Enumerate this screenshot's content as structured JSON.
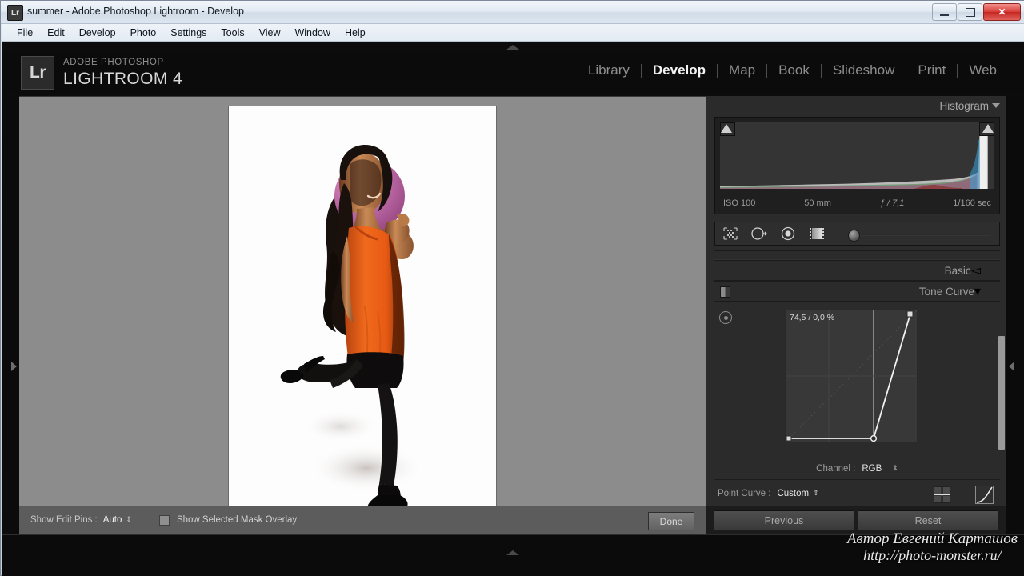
{
  "window": {
    "title": "summer - Adobe Photoshop Lightroom - Develop",
    "app_icon": "Lr",
    "minimize_label": "Minimize",
    "maximize_label": "Maximize",
    "close_label": "✕"
  },
  "menu": {
    "items": [
      {
        "label": "File"
      },
      {
        "label": "Edit"
      },
      {
        "label": "Develop"
      },
      {
        "label": "Photo"
      },
      {
        "label": "Settings"
      },
      {
        "label": "Tools"
      },
      {
        "label": "View"
      },
      {
        "label": "Window"
      },
      {
        "label": "Help"
      }
    ]
  },
  "identity": {
    "badge": "Lr",
    "line1": "ADOBE PHOTOSHOP",
    "line2": "LIGHTROOM 4"
  },
  "modules": {
    "items": [
      {
        "label": "Library",
        "active": false
      },
      {
        "label": "Develop",
        "active": true
      },
      {
        "label": "Map",
        "active": false
      },
      {
        "label": "Book",
        "active": false
      },
      {
        "label": "Slideshow",
        "active": false
      },
      {
        "label": "Print",
        "active": false
      },
      {
        "label": "Web",
        "active": false
      }
    ]
  },
  "histogram": {
    "title": "Histogram",
    "meta": {
      "iso": "ISO 100",
      "focal": "50 mm",
      "aperture": "ƒ / 7,1",
      "shutter": "1/160 sec"
    },
    "shadow_clip_label": "Shadow clipping",
    "highlight_clip_label": "Highlight clipping"
  },
  "tools": {
    "items": [
      {
        "name": "crop-overlay-tool",
        "label": "Crop Overlay"
      },
      {
        "name": "spot-removal-tool",
        "label": "Spot Removal"
      },
      {
        "name": "red-eye-tool",
        "label": "Red Eye Correction"
      },
      {
        "name": "graduated-filter-tool",
        "label": "Graduated Filter"
      },
      {
        "name": "adjustment-brush-tool",
        "label": "Adjustment Brush"
      }
    ]
  },
  "panels": {
    "basic": {
      "title": "Basic"
    },
    "tone_curve": {
      "title": "Tone Curve",
      "readout": "74,5 / 0,0 %",
      "channel_label": "Channel :",
      "channel_value": "RGB",
      "point_curve_label": "Point Curve :",
      "point_curve_value": "Custom"
    }
  },
  "toolbar": {
    "show_edit_pins_label": "Show Edit Pins :",
    "show_edit_pins_value": "Auto",
    "mask_overlay_label": "Show Selected Mask Overlay",
    "done_label": "Done"
  },
  "bottom_buttons": {
    "previous_label": "Previous",
    "reset_label": "Reset"
  },
  "watermark": {
    "line1": "Автор Евгений Карташов",
    "line2": "http://photo-monster.ru/"
  },
  "colors": {
    "panel_bg": "#2b2b2b",
    "canvas_bg": "#8c8c8c",
    "accent_text": "#f2f2f2",
    "dress_orange": "#e8601c",
    "balloon_pink": "#c471ac"
  }
}
